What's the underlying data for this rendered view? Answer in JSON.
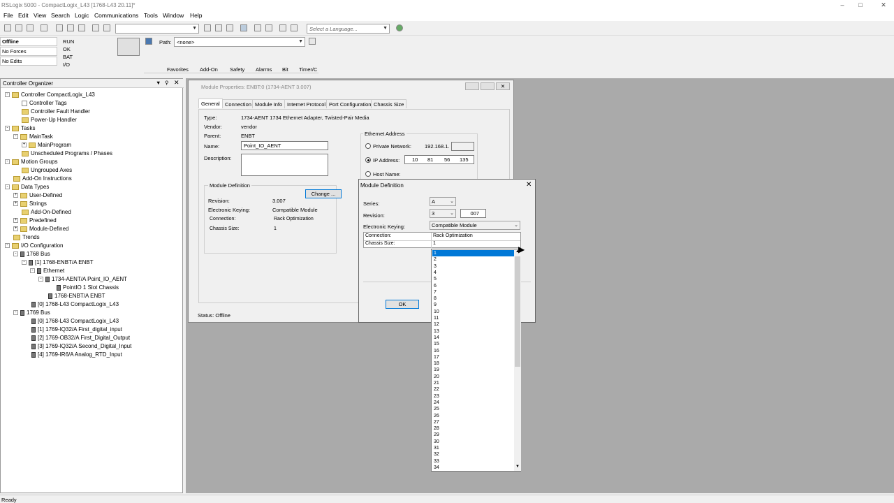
{
  "window": {
    "title": "RSLogix 5000 - CompactLogix_L43 [1768-L43 20.11]*"
  },
  "menu": [
    "File",
    "Edit",
    "View",
    "Search",
    "Logic",
    "Communications",
    "Tools",
    "Window",
    "Help"
  ],
  "toolbar": {
    "language_placeholder": "Select a Language..."
  },
  "controller_status": {
    "mode": "Offline",
    "forces": "No Forces",
    "edits": "No Edits",
    "leds": [
      "RUN",
      "OK",
      "BAT",
      "I/O"
    ]
  },
  "path": {
    "label": "Path:",
    "value": "<none>"
  },
  "instruction_tabs": [
    "Favorites",
    "Add-On",
    "Safety",
    "Alarms",
    "Bit",
    "Timer/C"
  ],
  "organizer": {
    "title": "Controller Organizer",
    "items": [
      "Controller CompactLogix_L43",
      "Controller Tags",
      "Controller Fault Handler",
      "Power-Up Handler",
      "Tasks",
      "MainTask",
      "MainProgram",
      "Unscheduled Programs / Phases",
      "Motion Groups",
      "Ungrouped Axes",
      "Add-On Instructions",
      "Data Types",
      "User-Defined",
      "Strings",
      "Add-On-Defined",
      "Predefined",
      "Module-Defined",
      "Trends",
      "I/O Configuration",
      "1768 Bus",
      "[1] 1768-ENBT/A ENBT",
      "Ethernet",
      "1734-AENT/A Point_IO_AENT",
      "PointIO 1 Slot Chassis",
      "1768-ENBT/A ENBT",
      "[0] 1768-L43 CompactLogix_L43",
      "1769 Bus",
      "[0] 1768-L43 CompactLogix_L43",
      "[1] 1769-IQ32/A First_digital_input",
      "[2] 1769-OB32/A First_Digital_Output",
      "[3] 1769-IQ32/A Second_Digital_Input",
      "[4] 1769-IR6/A Analog_RTD_Input"
    ]
  },
  "module_props": {
    "title": "Module Properties: ENBT:0 (1734-AENT 3.007)",
    "tabs": [
      "General",
      "Connection",
      "Module Info",
      "Internet Protocol",
      "Port Configuration",
      "Chassis Size"
    ],
    "type_label": "Type:",
    "type": "1734-AENT 1734 Ethernet Adapter, Twisted-Pair Media",
    "vendor_label": "Vendor:",
    "vendor": "vendor",
    "parent_label": "Parent:",
    "parent": "ENBT",
    "name_label": "Name:",
    "name": "Point_IO_AENT",
    "desc_label": "Description:",
    "moddef_title": "Module Definition",
    "change": "Change ...",
    "revision_label": "Revision:",
    "revision": "3.007",
    "keying_label": "Electronic Keying:",
    "keying": "Compatible Module",
    "connection_label": "Connection:",
    "connection": "Rack Optimization",
    "chassis_label": "Chassis Size:",
    "chassis": "1",
    "eth_title": "Ethernet Address",
    "private_label": "Private Network:",
    "private_value": "192.168.1.",
    "ip_label": "IP Address:",
    "ip": [
      "10",
      "81",
      "56",
      "135"
    ],
    "host_label": "Host Name:",
    "status": "Status:  Offline"
  },
  "module_def": {
    "title": "Module Definition",
    "series_label": "Series:",
    "series": "A",
    "revision_label": "Revision:",
    "rev_major": "3",
    "rev_minor": "007",
    "keying_label": "Electronic Keying:",
    "keying": "Compatible Module",
    "connection_label": "Connection:",
    "connection": "Rack Optimization",
    "chassis_label": "Chassis Size:",
    "chassis": "1",
    "ok": "OK",
    "options": [
      "1",
      "2",
      "3",
      "4",
      "5",
      "6",
      "7",
      "8",
      "9",
      "10",
      "11",
      "12",
      "13",
      "14",
      "15",
      "16",
      "17",
      "18",
      "19",
      "20",
      "21",
      "22",
      "23",
      "24",
      "25",
      "26",
      "27",
      "28",
      "29",
      "30",
      "31",
      "32",
      "33",
      "34"
    ]
  },
  "statusbar": {
    "text": "Ready"
  }
}
